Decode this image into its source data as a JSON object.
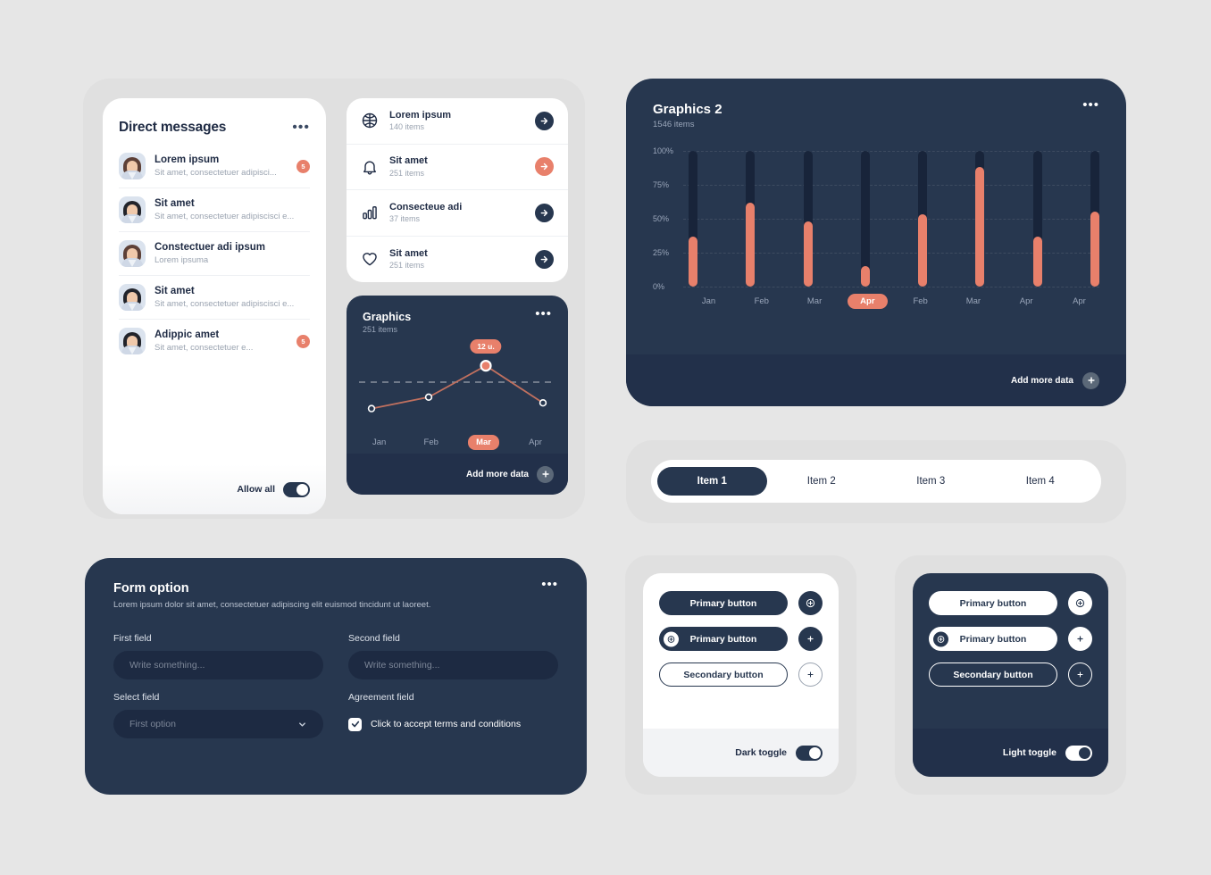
{
  "theme": {
    "page_bg": "#e6e6e6",
    "shell_bg": "#e0e0e0",
    "navy": "#27374f",
    "navy_deep": "#22304a",
    "accent": "#e8806b",
    "muted": "#9aa6ba"
  },
  "direct_messages": {
    "title": "Direct messages",
    "more_label": "•••",
    "items": [
      {
        "name": "Lorem ipsum",
        "preview": "Sit amet, consectetuer adipisci...",
        "badge": "5"
      },
      {
        "name": "Sit amet",
        "preview": "Sit amet, consectetuer adipiscisci e...",
        "badge": ""
      },
      {
        "name": "Constectuer adi ipsum",
        "preview": "Lorem ipsuma",
        "badge": ""
      },
      {
        "name": "Sit amet",
        "preview": "Sit amet, consectetuer adipiscisci e...",
        "badge": ""
      },
      {
        "name": "Adippic amet",
        "preview": "Sit amet, consectetuer e...",
        "badge": "5"
      }
    ],
    "footer": {
      "label": "Allow all",
      "toggle_on": true
    }
  },
  "menu_card": {
    "items": [
      {
        "icon": "basketball-icon",
        "name": "Lorem ipsum",
        "sub": "140 items",
        "accent": false
      },
      {
        "icon": "bell-icon",
        "name": "Sit amet",
        "sub": "251 items",
        "accent": true
      },
      {
        "icon": "bar-chart-icon",
        "name": "Consecteue adi",
        "sub": "37 items",
        "accent": false
      },
      {
        "icon": "heart-icon",
        "name": "Sit amet",
        "sub": "251 items",
        "accent": false
      }
    ]
  },
  "graphics": {
    "title": "Graphics",
    "subtitle": "251 items",
    "more_label": "•••",
    "tooltip": "12 u.",
    "footer_label": "Add more data",
    "add_icon": "plus-icon"
  },
  "graphics2": {
    "title": "Graphics  2",
    "subtitle": "1546 items",
    "more_label": "•••",
    "footer_label": "Add more data",
    "add_icon": "plus-icon"
  },
  "tabs": {
    "items": [
      {
        "label": "Item 1",
        "active": true
      },
      {
        "label": "Item 2",
        "active": false
      },
      {
        "label": "Item 3",
        "active": false
      },
      {
        "label": "Item 4",
        "active": false
      }
    ]
  },
  "form": {
    "title": "Form option",
    "description": "Lorem ipsum dolor sit amet, consectetuer adipiscing elit euismod tincidunt ut laoreet.",
    "more_label": "•••",
    "first_field": {
      "label": "First field",
      "placeholder": "Write something...",
      "value": ""
    },
    "second_field": {
      "label": "Second field",
      "placeholder": "Write something...",
      "value": ""
    },
    "select_field": {
      "label": "Select field",
      "value": "First option"
    },
    "agreement_field": {
      "label": "Agreement field",
      "checkbox_label": "Click to accept terms and conditions",
      "checked": true
    }
  },
  "button_panel_light": {
    "primary_label": "Primary button",
    "primary_icon_label": "Primary button",
    "secondary_label": "Secondary button",
    "footer_label": "Dark toggle",
    "toggle_on": true
  },
  "button_panel_dark": {
    "primary_label": "Primary button",
    "primary_icon_label": "Primary button",
    "secondary_label": "Secondary button",
    "footer_label": "Light toggle",
    "toggle_on": true
  },
  "chart_data": [
    {
      "type": "line",
      "title": "Graphics",
      "subtitle": "251 items",
      "categories": [
        "Jan",
        "Feb",
        "Mar",
        "Apr"
      ],
      "values": [
        18,
        34,
        78,
        26
      ],
      "highlight_category": "Mar",
      "highlight_value_label": "12 u.",
      "ylim": [
        0,
        100
      ],
      "grid": true,
      "grid_lines": [
        55
      ],
      "legend": "none",
      "xlabel": "",
      "ylabel": ""
    },
    {
      "type": "bar",
      "title": "Graphics  2",
      "subtitle": "1546 items",
      "categories": [
        "Jan",
        "Feb",
        "Mar",
        "Apr",
        "Feb",
        "Mar",
        "Apr",
        "Apr"
      ],
      "values": [
        37,
        62,
        48,
        15,
        53,
        88,
        37,
        55
      ],
      "track_max": 100,
      "highlight_category_index": 3,
      "yticks": [
        "0%",
        "25%",
        "50%",
        "75%",
        "100%"
      ],
      "ytick_values": [
        0,
        25,
        50,
        75,
        100
      ],
      "ylim": [
        0,
        100
      ],
      "grid": true,
      "legend": "none",
      "xlabel": "",
      "ylabel": ""
    }
  ]
}
